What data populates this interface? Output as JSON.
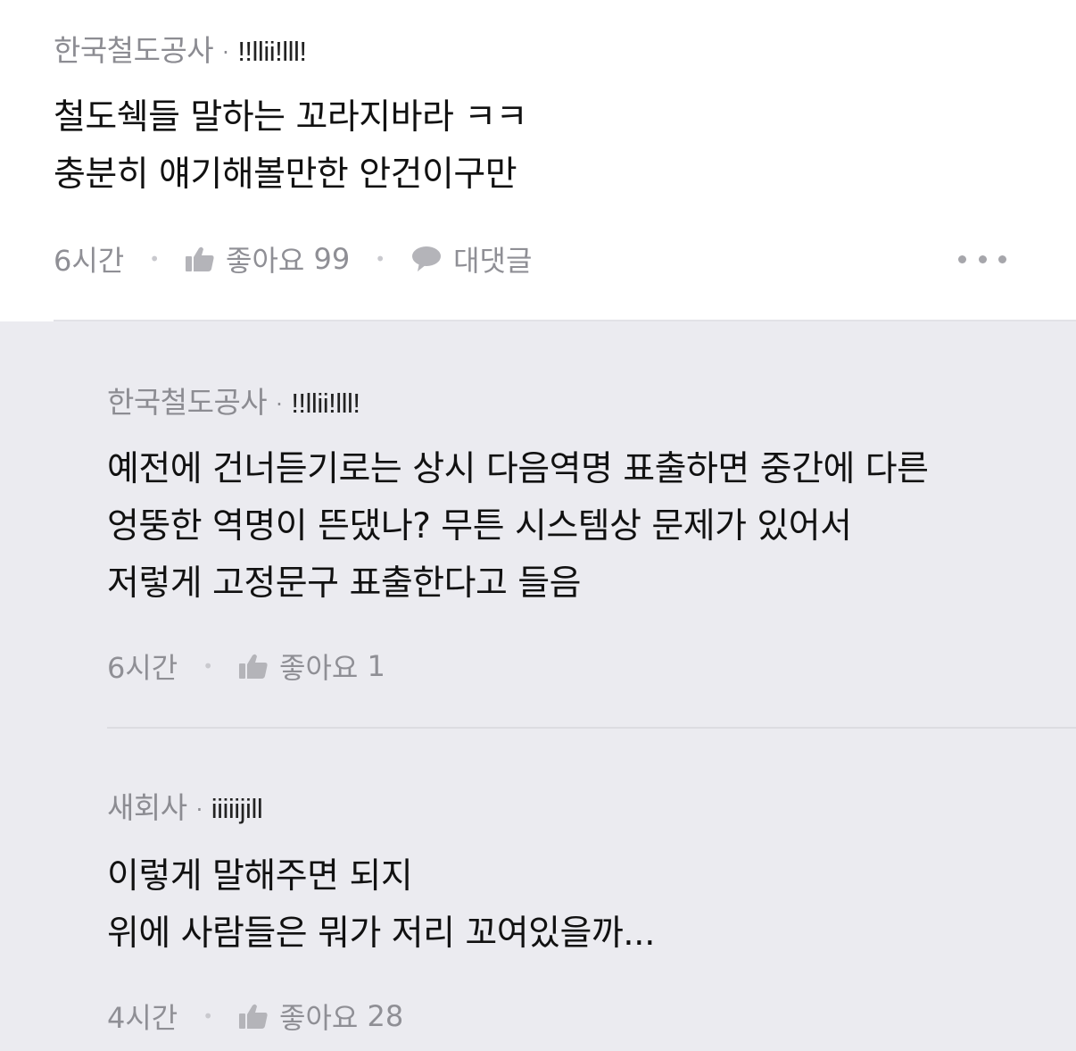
{
  "comments": [
    {
      "nickname": "한국철도공사",
      "separator": "·",
      "user_id": "!!llii!lll!",
      "lines": [
        "철도쉑들 말하는 꼬라지바라 ㅋㅋ",
        "충분히 얘기해볼만한 안건이구만"
      ],
      "time": "6시간",
      "like_label": "좋아요",
      "like_count": "99",
      "reply_label": "대댓글"
    }
  ],
  "replies": [
    {
      "nickname": "한국철도공사",
      "separator": "·",
      "user_id": "!!llii!lll!",
      "lines": [
        "예전에 건너듣기로는 상시 다음역명 표출하면 중간에 다른",
        "엉뚱한 역명이 뜬댔나? 무튼 시스템상 문제가 있어서",
        "저렇게 고정문구 표출한다고 들음"
      ],
      "time": "6시간",
      "like_label": "좋아요",
      "like_count": "1"
    },
    {
      "nickname": "새회사",
      "separator": "·",
      "user_id": "iiiiijill",
      "lines": [
        "이렇게 말해주면 되지",
        "위에 사람들은 뭐가 저리 꼬여있을까..."
      ],
      "time": "4시간",
      "like_label": "좋아요",
      "like_count": "28"
    }
  ],
  "colors": {
    "reply_background": "#ebebf0",
    "meta_text": "#8c8c92",
    "body_text": "#111111"
  },
  "icons": {
    "like": "thumbs-up-icon",
    "reply": "speech-bubble-icon",
    "more": "more-dots-icon"
  }
}
